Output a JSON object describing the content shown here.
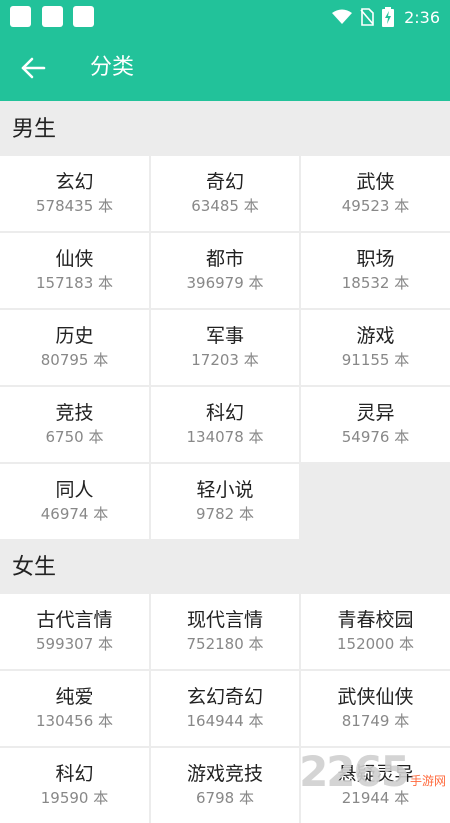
{
  "status_bar": {
    "time": "2:36",
    "icons": [
      "wifi-icon",
      "no-sim-icon",
      "battery-charging-icon"
    ]
  },
  "appbar": {
    "title": "分类",
    "back_icon": "arrow-left-icon"
  },
  "sections": [
    {
      "title": "男生",
      "items": [
        {
          "name": "玄幻",
          "count": "578435 本"
        },
        {
          "name": "奇幻",
          "count": "63485 本"
        },
        {
          "name": "武侠",
          "count": "49523 本"
        },
        {
          "name": "仙侠",
          "count": "157183 本"
        },
        {
          "name": "都市",
          "count": "396979 本"
        },
        {
          "name": "职场",
          "count": "18532 本"
        },
        {
          "name": "历史",
          "count": "80795 本"
        },
        {
          "name": "军事",
          "count": "17203 本"
        },
        {
          "name": "游戏",
          "count": "91155 本"
        },
        {
          "name": "竞技",
          "count": "6750 本"
        },
        {
          "name": "科幻",
          "count": "134078 本"
        },
        {
          "name": "灵异",
          "count": "54976 本"
        },
        {
          "name": "同人",
          "count": "46974 本"
        },
        {
          "name": "轻小说",
          "count": "9782 本"
        }
      ]
    },
    {
      "title": "女生",
      "items": [
        {
          "name": "古代言情",
          "count": "599307 本"
        },
        {
          "name": "现代言情",
          "count": "752180 本"
        },
        {
          "name": "青春校园",
          "count": "152000 本"
        },
        {
          "name": "纯爱",
          "count": "130456 本"
        },
        {
          "name": "玄幻奇幻",
          "count": "164944 本"
        },
        {
          "name": "武侠仙侠",
          "count": "81749 本"
        },
        {
          "name": "科幻",
          "count": "19590 本"
        },
        {
          "name": "游戏竞技",
          "count": "6798 本"
        },
        {
          "name": "悬疑灵异",
          "count": "21944 本"
        }
      ]
    }
  ],
  "watermark": {
    "logo_text": "2265",
    "site_text": "手游网"
  },
  "colors": {
    "accent": "#22c29a",
    "background": "#ececec",
    "cell": "#ffffff"
  }
}
